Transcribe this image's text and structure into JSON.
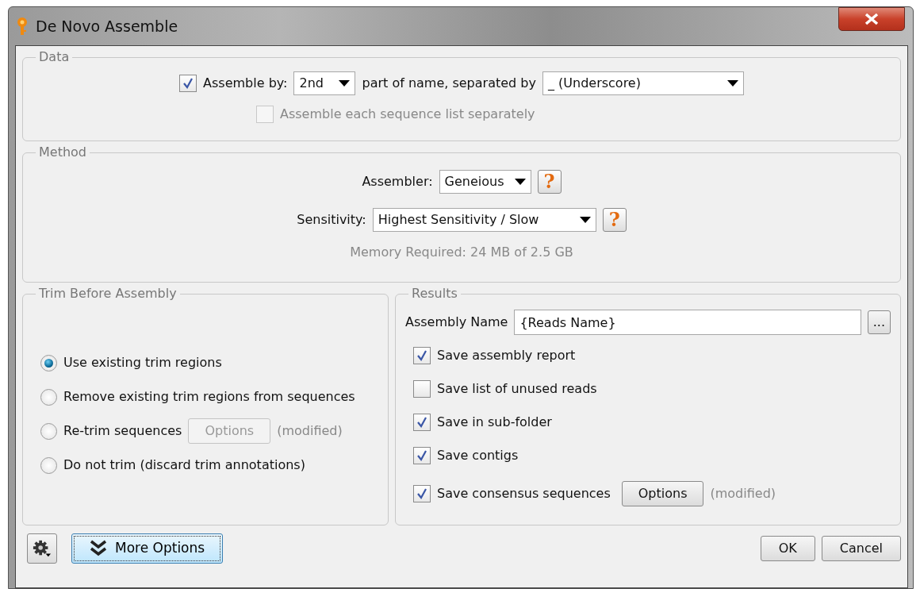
{
  "window": {
    "title": "De Novo Assemble"
  },
  "data": {
    "title": "Data",
    "assemble_by": {
      "checked": true,
      "label": "Assemble by:",
      "part": "2nd",
      "middle": "part of name, separated by",
      "separator": "_ (Underscore)"
    },
    "separately": {
      "checked": false,
      "disabled": true,
      "label": "Assemble each sequence list separately"
    }
  },
  "method": {
    "title": "Method",
    "rows": [
      {
        "label": "Assembler:",
        "value": "Geneious",
        "help": "?"
      },
      {
        "label": "Sensitivity:",
        "value": "Highest Sensitivity / Slow",
        "help": "?"
      }
    ],
    "memory": "Memory Required: 24 MB of 2.5 GB"
  },
  "trim": {
    "title": "Trim Before Assembly",
    "options": [
      {
        "label": "Use existing trim regions",
        "selected": true
      },
      {
        "label": "Remove existing trim regions from sequences",
        "selected": false
      },
      {
        "label": "Re-trim sequences",
        "selected": false,
        "button": {
          "label": "Options",
          "disabled": true
        },
        "note": "(modified)"
      },
      {
        "label": "Do not trim (discard trim annotations)",
        "selected": false
      }
    ]
  },
  "results": {
    "title": "Results",
    "name_label": "Assembly Name",
    "name_value": "{Reads Name}",
    "browse": "...",
    "checks": [
      {
        "label": "Save assembly report",
        "checked": true
      },
      {
        "label": "Save list of unused reads",
        "checked": false
      },
      {
        "label": "Save in sub-folder",
        "checked": true
      },
      {
        "label": "Save contigs",
        "checked": true
      },
      {
        "label": "Save consensus sequences",
        "checked": true,
        "button": {
          "label": "Options",
          "disabled": false
        },
        "note": "(modified)"
      }
    ]
  },
  "footer": {
    "more": "More Options",
    "buttons": [
      "OK",
      "Cancel"
    ]
  }
}
